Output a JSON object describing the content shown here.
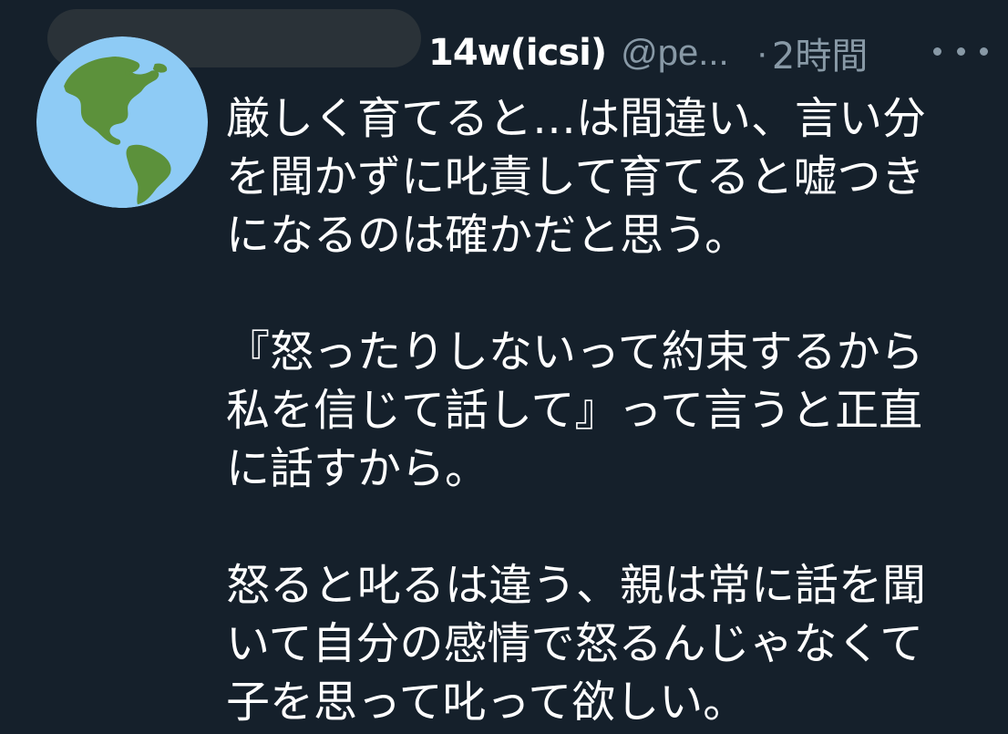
{
  "tweet": {
    "author": {
      "display_name": "14w(icsi)",
      "handle": "@pe...",
      "avatar_icon": "globe-americas-icon"
    },
    "separator": "·",
    "time": "2時間",
    "more_icon": "more-options-icon",
    "lines": [
      "厳しく育てると…は間違い、言い分",
      "を聞かずに叱責して育てると嘘つき",
      "になるのは確かだと思う。",
      "",
      "『怒ったりしないって約束するから",
      "私を信じて話して』って言うと正直",
      "に話すから。",
      "",
      "怒ると叱るは違う、親は常に話を聞",
      "いて自分の感情で怒るんじゃなくて",
      "子を思って叱って欲しい。"
    ]
  },
  "colors": {
    "background": "#15202b",
    "text": "#ffffff",
    "secondary_text": "#8899a6",
    "redaction": "#2a3238",
    "globe_ocean": "#8ecbf5",
    "globe_land": "#5c913b"
  }
}
